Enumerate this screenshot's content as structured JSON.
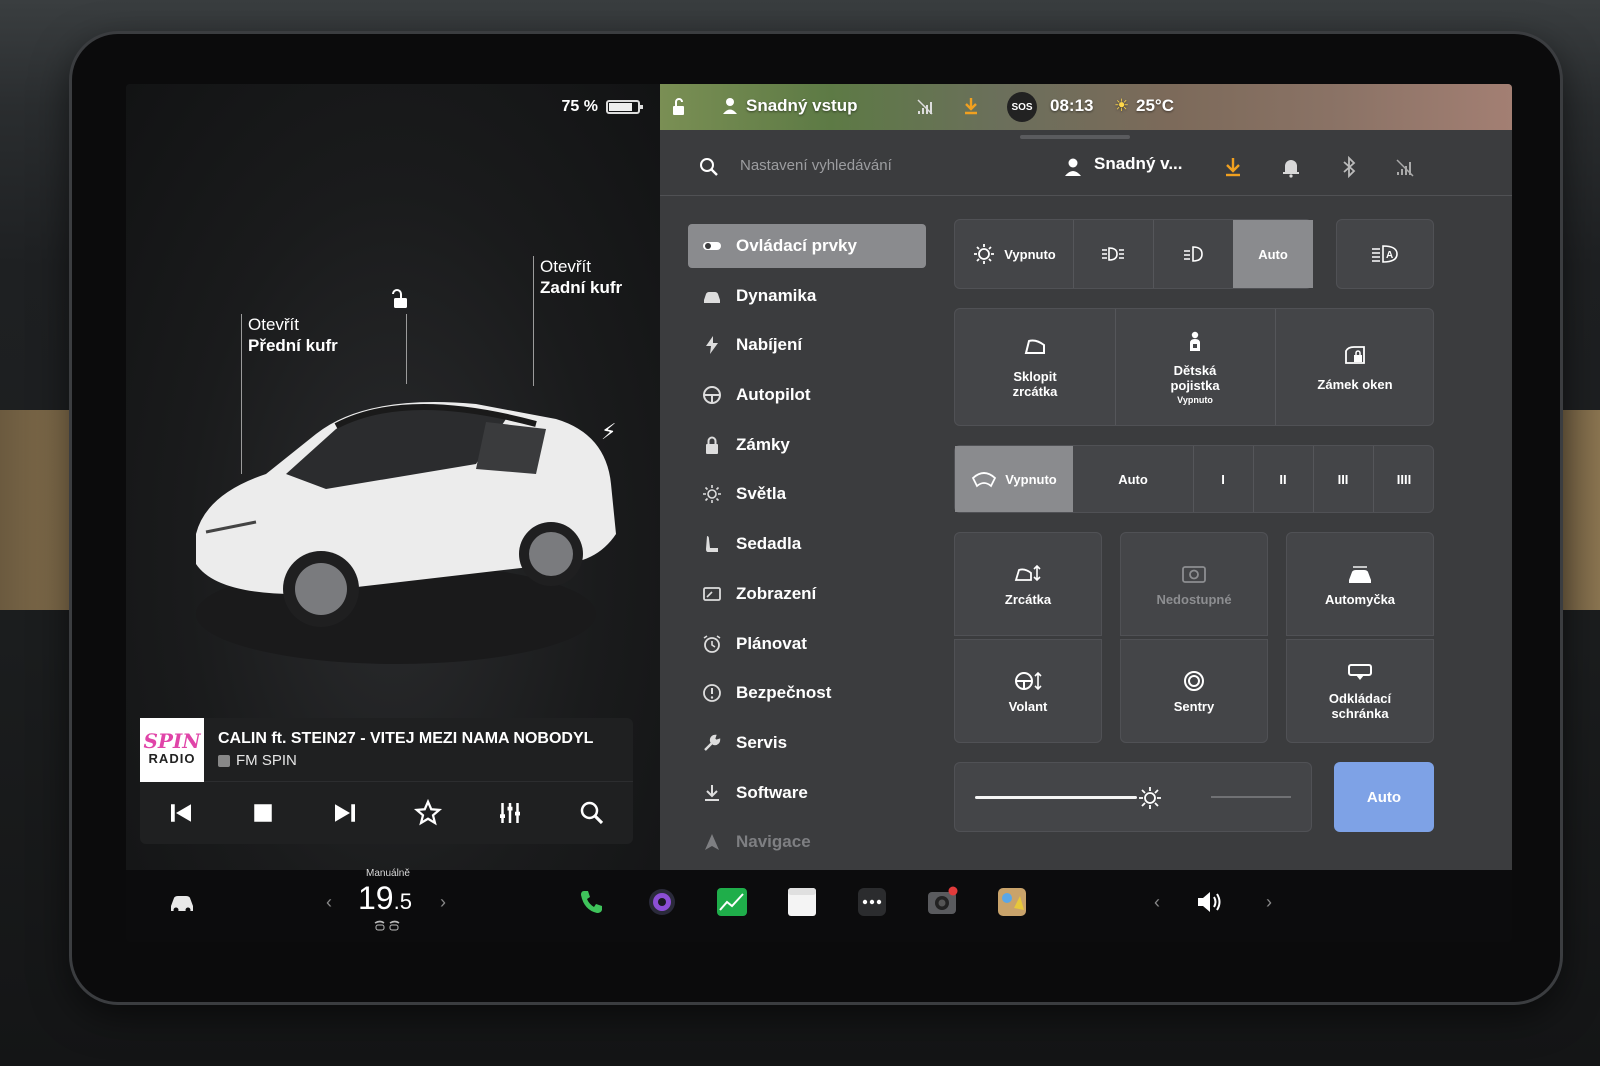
{
  "status": {
    "battery_percent_label": "75 %",
    "battery_level": 0.75,
    "profile_name": "Snadný vstup",
    "time": "08:13",
    "temperature": "25°C",
    "sos_label": "SOS"
  },
  "car_view": {
    "front_trunk": {
      "line1": "Otevřít",
      "line2": "Přední kufr"
    },
    "rear_trunk": {
      "line1": "Otevřít",
      "line2": "Zadní kufr"
    }
  },
  "media": {
    "logo_line1": "SPIN",
    "logo_line2": "RADIO",
    "track_title": "CALIN ft. STEIN27 - VITEJ MEZI NAMA NOBODYL",
    "station": "FM SPIN"
  },
  "settings": {
    "search_placeholder": "Nastavení vyhledávání",
    "profile_short": "Snadný v...",
    "nav": [
      {
        "label": "Ovládací prvky",
        "icon": "toggle-icon",
        "active": true
      },
      {
        "label": "Dynamika",
        "icon": "car-icon"
      },
      {
        "label": "Nabíjení",
        "icon": "bolt-icon"
      },
      {
        "label": "Autopilot",
        "icon": "steering-wheel-icon"
      },
      {
        "label": "Zámky",
        "icon": "lock-icon"
      },
      {
        "label": "Světla",
        "icon": "sun-icon"
      },
      {
        "label": "Sedadla",
        "icon": "seat-icon"
      },
      {
        "label": "Zobrazení",
        "icon": "display-icon"
      },
      {
        "label": "Plánovat",
        "icon": "alarm-clock-icon"
      },
      {
        "label": "Bezpečnost",
        "icon": "info-circle-icon"
      },
      {
        "label": "Servis",
        "icon": "wrench-icon"
      },
      {
        "label": "Software",
        "icon": "download-icon"
      },
      {
        "label": "Navigace",
        "icon": "navigation-arrow-icon"
      }
    ],
    "lights": {
      "off_label": "Vypnuto",
      "auto_label": "Auto",
      "selected": "Auto"
    },
    "quick_controls": [
      {
        "label": "Sklopit zrcátka",
        "icon": "mirror-icon"
      },
      {
        "label": "Dětská pojistka",
        "sub": "Vypnuto",
        "icon": "child-lock-icon"
      },
      {
        "label": "Zámek oken",
        "icon": "window-lock-icon"
      }
    ],
    "wipers": {
      "options": [
        "Vypnuto",
        "Auto",
        "I",
        "II",
        "III",
        "IIII"
      ],
      "selected": "Vypnuto"
    },
    "tiles": [
      {
        "label": "Zrcátka",
        "icon": "mirror-adjust-icon",
        "enabled": true
      },
      {
        "label": "Nedostupné",
        "icon": "camera-icon",
        "enabled": false
      },
      {
        "label": "Automyčka",
        "icon": "car-wash-icon",
        "enabled": true
      },
      {
        "label": "Volant",
        "icon": "steering-adjust-icon",
        "enabled": true
      },
      {
        "label": "Sentry",
        "icon": "sentry-icon",
        "enabled": true
      },
      {
        "label": "Odkládací schránka",
        "icon": "glovebox-icon",
        "enabled": true
      }
    ],
    "brightness": {
      "level": 0.55,
      "auto_label": "Auto"
    }
  },
  "dock": {
    "climate_mode": "Manuálně",
    "temp_whole": "19",
    "temp_decimal": ".5"
  },
  "colors": {
    "accent_blue": "#7ea2e6",
    "selected_grey": "#8a8b8e",
    "download_orange": "#f0a020"
  }
}
